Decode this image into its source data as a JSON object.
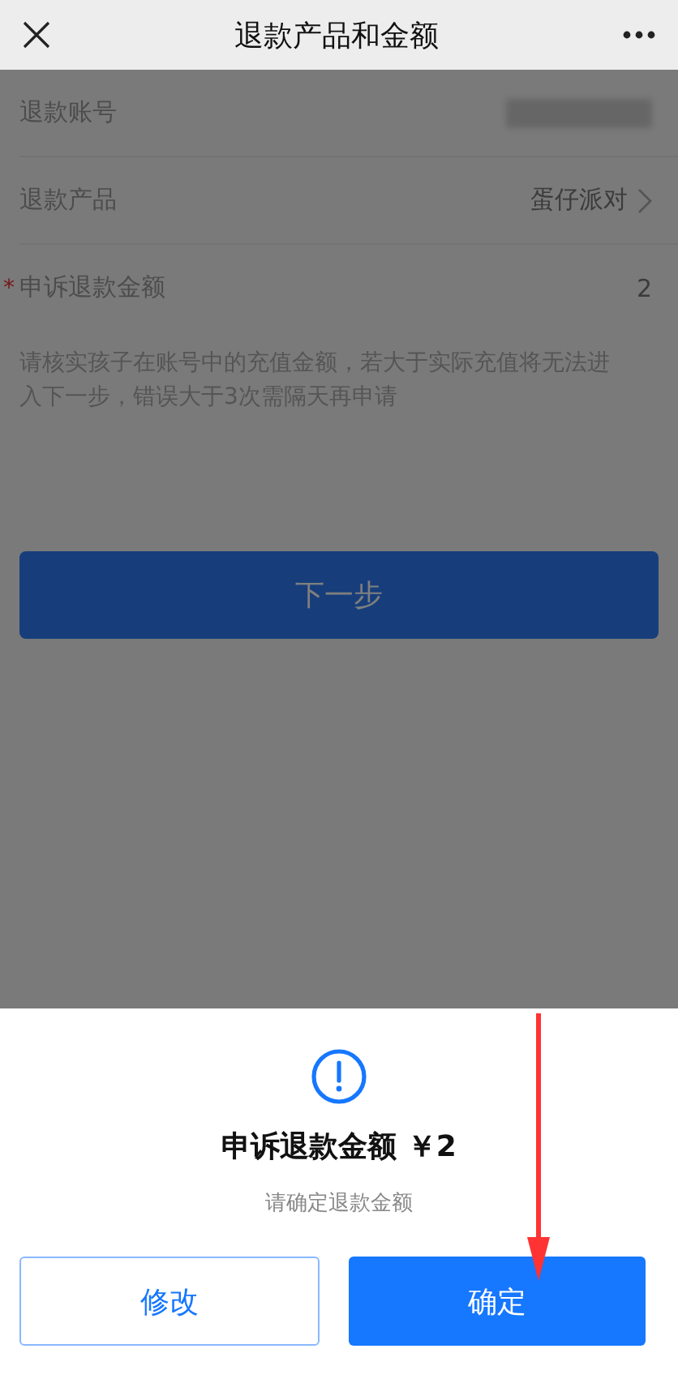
{
  "header": {
    "title": "退款产品和金额"
  },
  "form": {
    "rows": [
      {
        "kind": "masked",
        "label": "退款账号"
      },
      {
        "kind": "select",
        "label": "退款产品",
        "value": "蛋仔派对"
      },
      {
        "kind": "value",
        "label": "申诉退款金额",
        "required_mark": "*",
        "value": "2"
      }
    ],
    "hint": "请核实孩子在账号中的充值金额，若大于实际充值将无法进入下一步，错误大于3次需隔天再申请",
    "next_button": "下一步"
  },
  "dialog": {
    "title": "申诉退款金额 ￥2",
    "message": "请确定退款金额",
    "buttons": [
      {
        "label": "修改",
        "kind": "secondary"
      },
      {
        "label": "确定",
        "kind": "primary"
      }
    ]
  }
}
